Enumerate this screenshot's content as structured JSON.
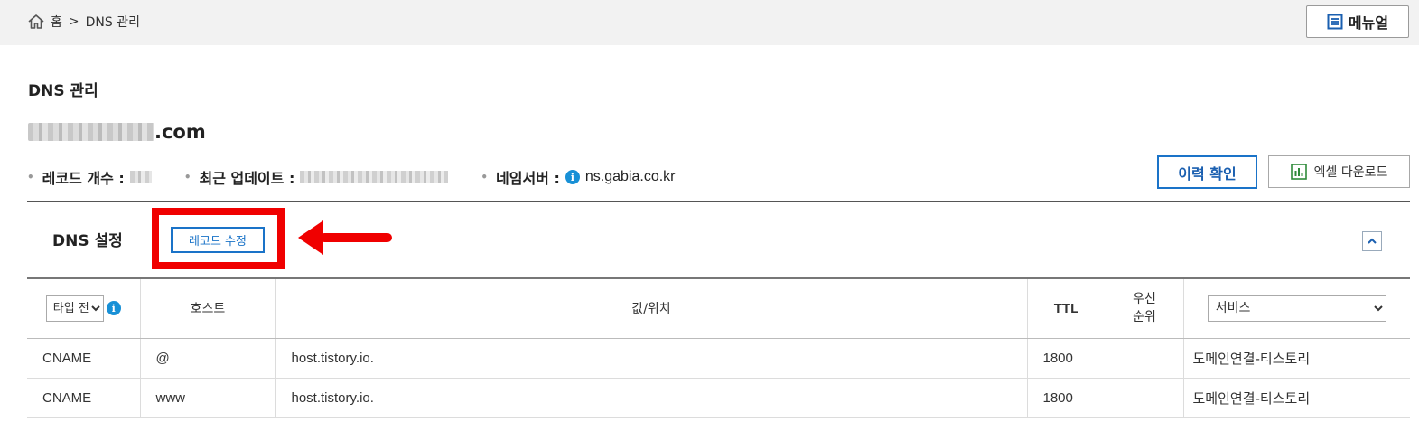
{
  "breadcrumb": {
    "home": "홈",
    "separator": ">",
    "current": "DNS 관리"
  },
  "manual_button": "메뉴얼",
  "page_title": "DNS 관리",
  "domain": {
    "suffix": ".com"
  },
  "info": {
    "record_count_label": "레코드 개수 :",
    "last_update_label": "최근 업데이트 :",
    "nameserver_label": "네임서버 :",
    "nameserver_value": "ns.gabia.co.kr"
  },
  "buttons": {
    "history": "이력 확인",
    "excel_download": "엑셀 다운로드",
    "record_edit": "레코드 수정"
  },
  "section_title": "DNS 설정",
  "table": {
    "type_select": "타입 전체",
    "headers": {
      "host": "호스트",
      "value": "값/위치",
      "ttl": "TTL",
      "priority_line1": "우선",
      "priority_line2": "순위",
      "service": "서비스"
    },
    "rows": [
      {
        "type": "CNAME",
        "host": "@",
        "value": "host.tistory.io.",
        "ttl": "1800",
        "priority": "",
        "service": "도메인연결-티스토리"
      },
      {
        "type": "CNAME",
        "host": "www",
        "value": "host.tistory.io.",
        "ttl": "1800",
        "priority": "",
        "service": "도메인연결-티스토리"
      }
    ]
  },
  "colors": {
    "accent_blue": "#1a73c8",
    "highlight_red": "#f00000",
    "info_icon": "#1890d6"
  }
}
